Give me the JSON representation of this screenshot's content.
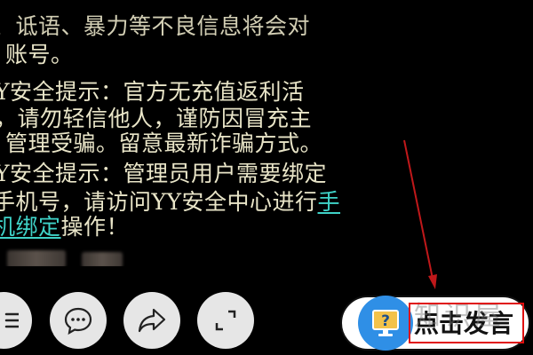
{
  "messages": [
    {
      "text": "、诋语、暴力等不良信息将会对"
    },
    {
      "text": "账号。"
    },
    {
      "text": "Y安全提示：官方无充值返利活"
    },
    {
      "text": "，请勿轻信他人，谨防因冒充主"
    },
    {
      "text": "管理受骗。留意最新诈骗方式。"
    },
    {
      "text": "Y安全提示：管理员用户需要绑定"
    },
    {
      "text_before": "手机号，请访问YY安全中心进行",
      "link": "手"
    },
    {
      "link": "机绑定",
      "text_after": "操作！"
    }
  ],
  "toolbar": {
    "menu_icon": "menu-icon",
    "chat_icon": "chat-bubble-icon",
    "share_icon": "share-arrow-icon",
    "fullscreen_icon": "fullscreen-icon"
  },
  "speak": {
    "label": "点击发言",
    "icon": "monitor-question-icon",
    "accent_color": "#2f8fe6",
    "highlight_color": "#e01010"
  },
  "watermark": "知识屋"
}
